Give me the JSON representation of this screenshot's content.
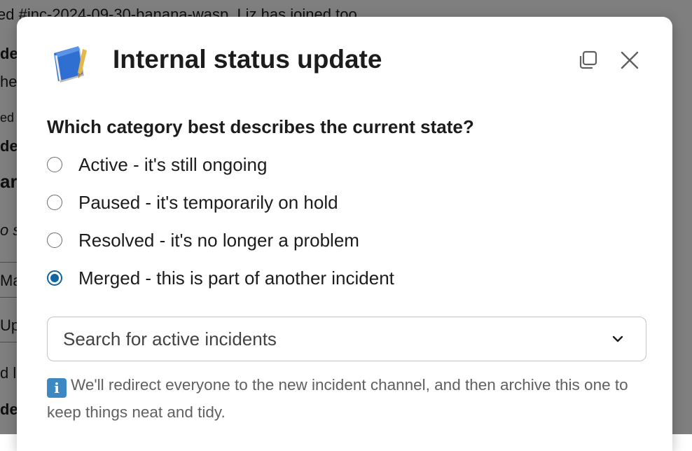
{
  "background": {
    "lines": [
      "ed #inc-2024-09-30-banana-wasp. Liz has joined too.",
      "de",
      "he",
      "ed",
      "de",
      "ar",
      "o s",
      "Ma",
      "Up",
      "d l",
      "de"
    ]
  },
  "modal": {
    "title": "Internal status update",
    "app_icon": "notebook-icon",
    "expand_icon": "expand-icon",
    "close_icon": "close-icon"
  },
  "form": {
    "question": "Which category best describes the current state?",
    "options": [
      {
        "label": "Active - it's still ongoing",
        "selected": false
      },
      {
        "label": "Paused - it's temporarily on hold",
        "selected": false
      },
      {
        "label": "Resolved - it's no longer a problem",
        "selected": false
      },
      {
        "label": "Merged - this is part of another incident",
        "selected": true
      }
    ],
    "select": {
      "placeholder": "Search for active incidents",
      "icon": "chevron-down-icon"
    },
    "info": {
      "icon": "information-icon",
      "icon_glyph": "i",
      "text": "We'll redirect everyone to the new incident channel, and then archive this one to keep things neat and tidy."
    }
  },
  "colors": {
    "accent": "#1264a3",
    "text": "#1d1c1d",
    "muted": "#616061"
  }
}
